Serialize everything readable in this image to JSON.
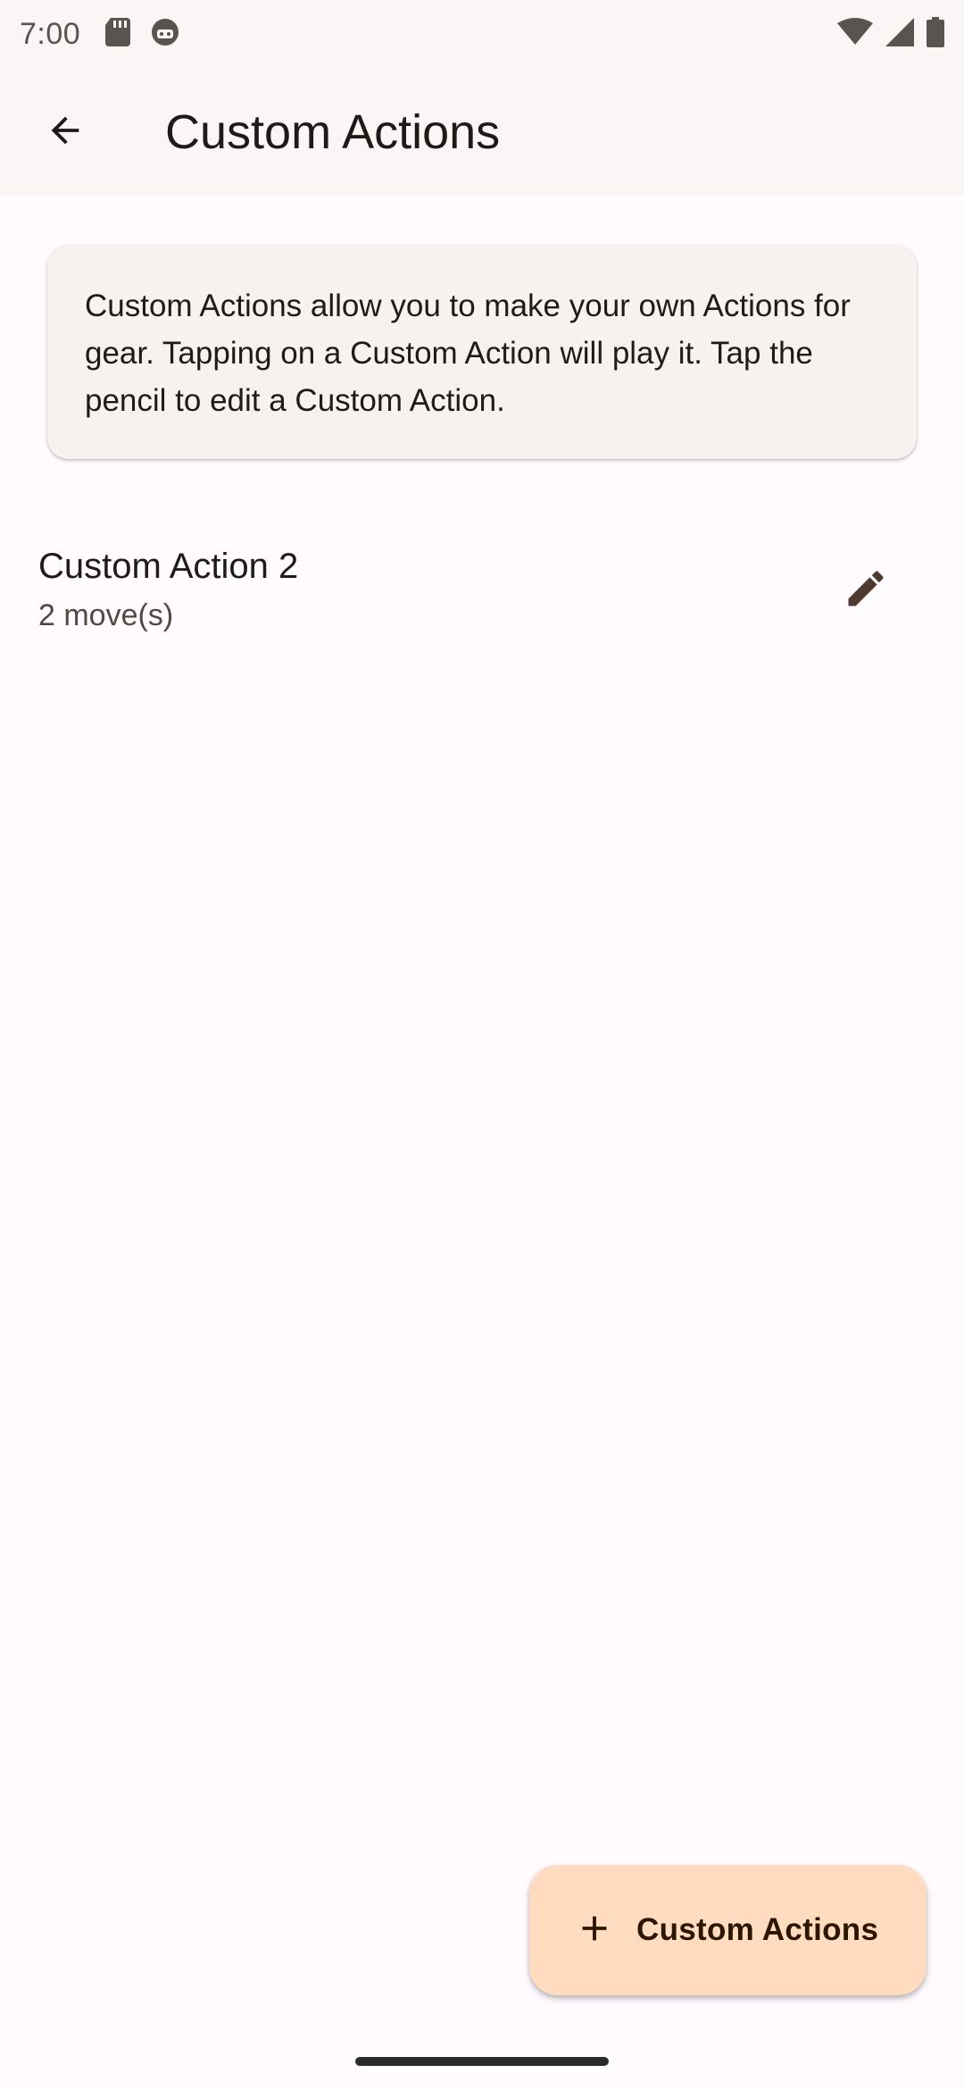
{
  "status_bar": {
    "time": "7:00",
    "left_icons": [
      "sd-card-icon",
      "android-debug-icon"
    ],
    "right_icons": [
      "wifi-icon",
      "cellular-signal-icon",
      "battery-icon"
    ]
  },
  "app_bar": {
    "back_icon": "arrow-back-icon",
    "title": "Custom Actions"
  },
  "info_card": {
    "text": "Custom Actions allow you to make your own Actions for gear. Tapping on a Custom Action will play it. Tap the pencil to edit a Custom Action."
  },
  "custom_actions": [
    {
      "title": "Custom Action 2",
      "subtitle": "2 move(s)",
      "action_icon": "pencil-edit-icon"
    }
  ],
  "fab": {
    "icon": "plus-icon",
    "label": "Custom Actions"
  },
  "colors": {
    "background": "#fffbfe",
    "app_bar": "#faf6f5",
    "card": "#f5f2f0",
    "fab": "#ffdcc0",
    "icon": "#4e3a2e"
  }
}
